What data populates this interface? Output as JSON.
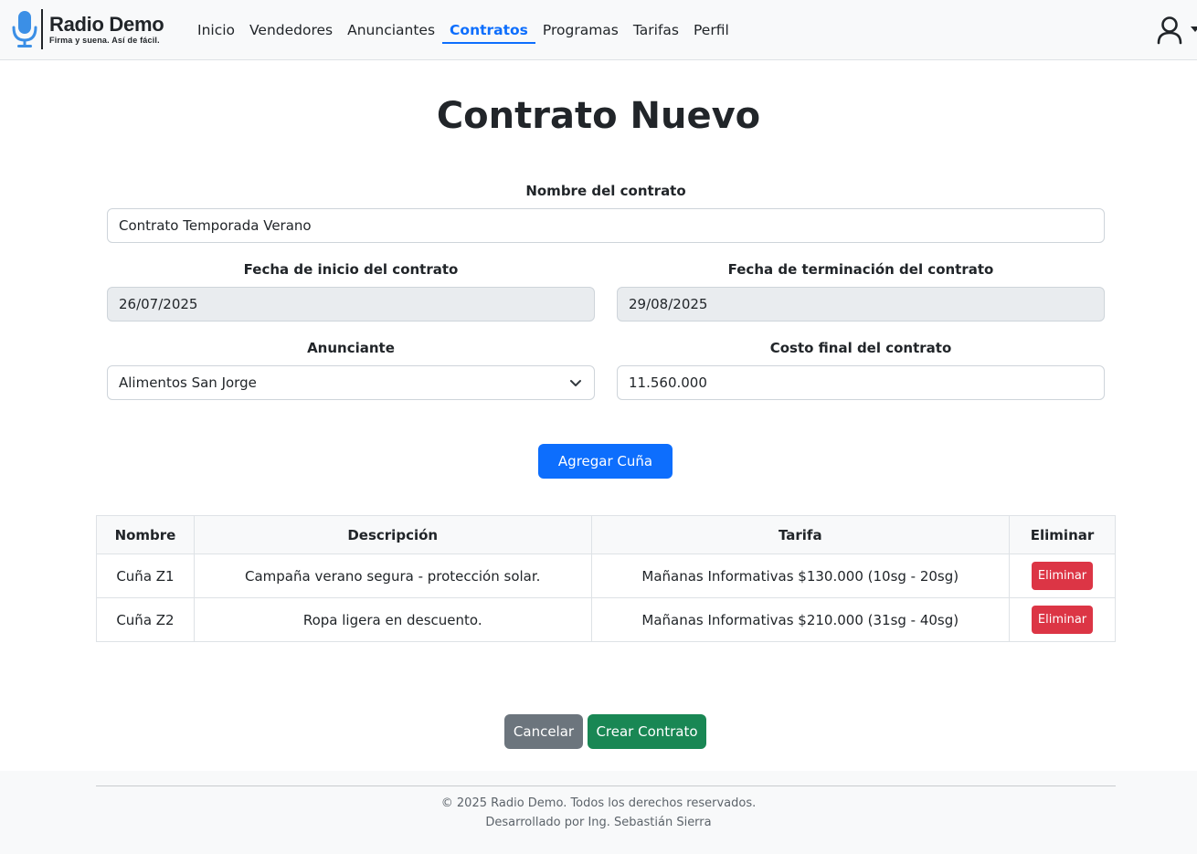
{
  "brand": {
    "title": "Radio Demo",
    "subtitle": "Firma y suena. Así de fácil."
  },
  "nav": {
    "items": [
      "Inicio",
      "Vendedores",
      "Anunciantes",
      "Contratos",
      "Programas",
      "Tarifas",
      "Perfil"
    ],
    "active": "Contratos"
  },
  "page": {
    "title": "Contrato Nuevo"
  },
  "form": {
    "name_label": "Nombre del contrato",
    "name_value": "Contrato Temporada Verano",
    "start_label": "Fecha de inicio del contrato",
    "start_value": "26/07/2025",
    "end_label": "Fecha de terminación del contrato",
    "end_value": "29/08/2025",
    "advertiser_label": "Anunciante",
    "advertiser_value": "Alimentos San Jorge",
    "cost_label": "Costo final del contrato",
    "cost_value": "11.560.000",
    "add_button": "Agregar Cuña"
  },
  "table": {
    "headers": [
      "Nombre",
      "Descripción",
      "Tarifa",
      "Eliminar"
    ],
    "rows": [
      {
        "name": "Cuña Z1",
        "description": "Campaña verano segura - protección solar.",
        "rate": "Mañanas Informativas $130.000 (10sg - 20sg)",
        "delete": "Eliminar"
      },
      {
        "name": "Cuña Z2",
        "description": "Ropa ligera en descuento.",
        "rate": "Mañanas Informativas $210.000 (31sg - 40sg)",
        "delete": "Eliminar"
      }
    ]
  },
  "actions": {
    "cancel": "Cancelar",
    "create": "Crear Contrato"
  },
  "footer": {
    "copyright": "© 2025 Radio Demo. Todos los derechos reservados.",
    "credit": "Desarrollado por Ing. Sebastián Sierra"
  },
  "colors": {
    "primary": "#0d6efd",
    "secondary": "#6c757d",
    "success": "#198754",
    "danger": "#dc3545",
    "brand_mic": "#3b8fe6"
  }
}
